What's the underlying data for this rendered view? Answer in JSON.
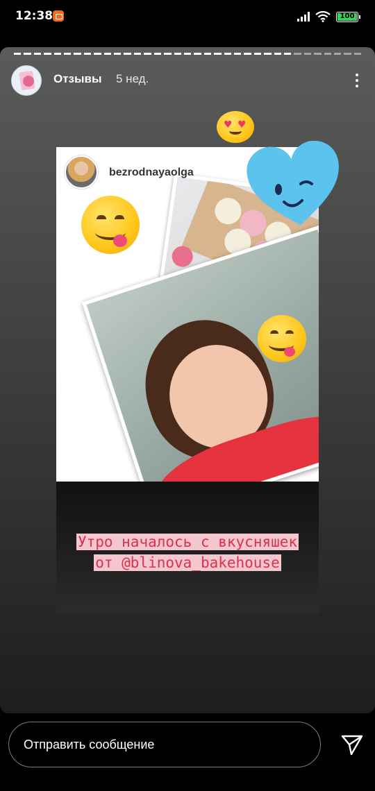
{
  "status_bar": {
    "time": "12:38",
    "battery": "100",
    "icons": [
      "app-notification-icon",
      "signal-icon",
      "wifi-icon",
      "battery-icon"
    ]
  },
  "story": {
    "name": "Отзывы",
    "time": "5 нед.",
    "progress_segments_done": 28,
    "progress_segments_total": 35
  },
  "repost": {
    "username": "bezrodnayaolga",
    "caption_line1": "Утро началось с вкусняшек",
    "caption_line2": "от @blinova_bakehouse"
  },
  "stickers": [
    "heart-eyes-emoji",
    "blue-heart-wink-sticker",
    "yum-emoji"
  ],
  "message_bar": {
    "placeholder": "Отправить сообщение"
  },
  "colors": {
    "caption_text": "#d9334b",
    "caption_highlight": "#f4c6cf",
    "heart_blue": "#5bc3ee",
    "battery_green": "#3ad15b"
  }
}
